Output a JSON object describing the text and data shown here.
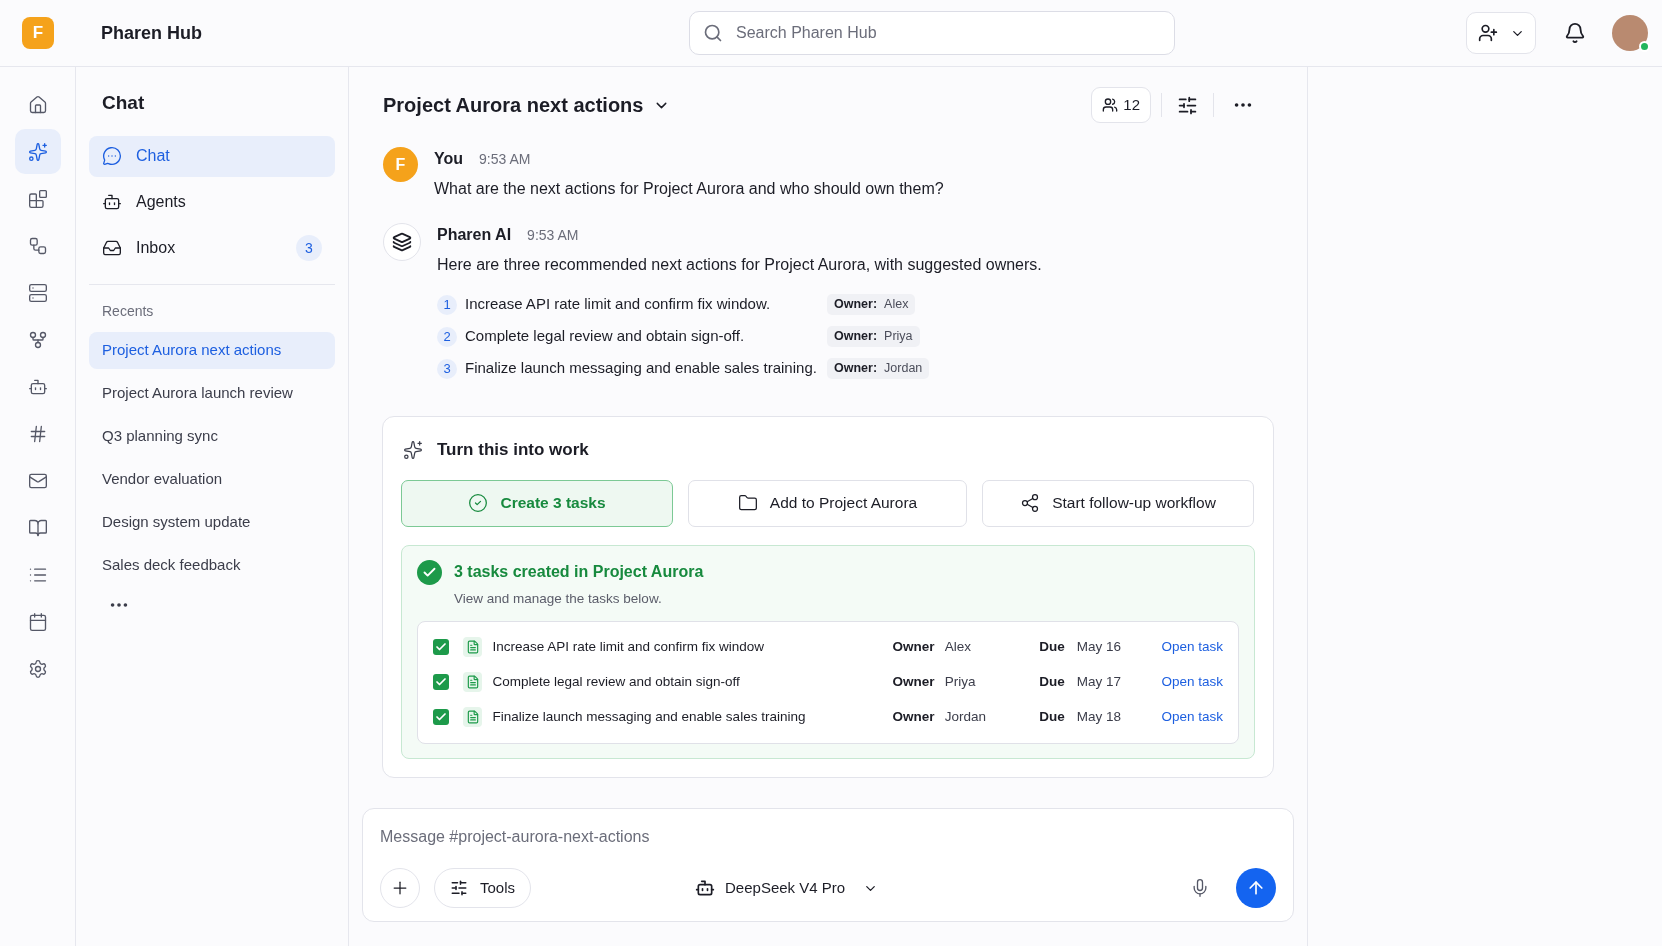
{
  "app": {
    "logo_letter": "F",
    "name": "Pharen Hub"
  },
  "search": {
    "placeholder": "Search Pharen Hub"
  },
  "user": {
    "online": true
  },
  "rail": [
    {
      "kind": "home",
      "selected": false
    },
    {
      "kind": "sparkles",
      "selected": true
    },
    {
      "kind": "blocks",
      "selected": false
    },
    {
      "kind": "flows",
      "selected": false
    },
    {
      "kind": "storage",
      "selected": false
    },
    {
      "kind": "nodes",
      "selected": false
    },
    {
      "kind": "bot",
      "selected": false
    },
    {
      "kind": "hash",
      "selected": false
    },
    {
      "kind": "mail",
      "selected": false
    },
    {
      "kind": "book",
      "selected": false
    },
    {
      "kind": "list",
      "selected": false
    },
    {
      "kind": "calendar",
      "selected": false
    },
    {
      "kind": "settings",
      "selected": false
    }
  ],
  "sidebar": {
    "title": "Chat",
    "items": [
      {
        "kind": "chat",
        "label": "Chat",
        "selected": true
      },
      {
        "kind": "agents",
        "label": "Agents",
        "selected": false
      },
      {
        "kind": "inbox",
        "label": "Inbox",
        "selected": false,
        "badge": "3"
      }
    ],
    "recents_label": "Recents",
    "recents": [
      {
        "label": "Project Aurora next actions",
        "selected": true
      },
      {
        "label": "Project Aurora launch review",
        "selected": false
      },
      {
        "label": "Q3 planning sync",
        "selected": false
      },
      {
        "label": "Vendor evaluation",
        "selected": false
      },
      {
        "label": "Design system update",
        "selected": false
      },
      {
        "label": "Sales deck feedback",
        "selected": false
      }
    ]
  },
  "chat": {
    "title": "Project Aurora next actions",
    "members": "12",
    "messages": [
      {
        "kind": "user",
        "avatar": "F",
        "author": "You",
        "time": "9:53 AM",
        "text": "What are the next actions for Project Aurora and who should own them?"
      },
      {
        "kind": "ai",
        "author": "Pharen AI",
        "time": "9:53 AM",
        "text": "Here are three recommended next actions for Project Aurora, with suggested owners.",
        "actions": [
          {
            "number": "1",
            "text": "Increase API rate limit and confirm fix window.",
            "owner_label": "Owner:",
            "owner": "Alex"
          },
          {
            "number": "2",
            "text": "Complete legal review and obtain sign-off.",
            "owner_label": "Owner:",
            "owner": "Priya"
          },
          {
            "number": "3",
            "text": "Finalize launch messaging and enable sales training.",
            "owner_label": "Owner:",
            "owner": "Jordan"
          }
        ]
      }
    ]
  },
  "work_card": {
    "title": "Turn this into work",
    "buttons": [
      {
        "kind": "tasks",
        "label": "Create 3 tasks",
        "selected": true
      },
      {
        "kind": "project",
        "label": "Add to Project Aurora",
        "selected": false
      },
      {
        "kind": "workflow",
        "label": "Start follow-up workflow",
        "selected": false
      }
    ],
    "result": {
      "title": "3 tasks created in Project Aurora",
      "subtitle": "View and manage the tasks below.",
      "tasks": [
        {
          "checked": true,
          "text": "Increase API rate limit and confirm fix window",
          "owner_label": "Owner",
          "owner": "Alex",
          "due_label": "Due",
          "due": "May 16",
          "link": "Open task"
        },
        {
          "checked": true,
          "text": "Complete legal review and obtain sign-off",
          "owner_label": "Owner",
          "owner": "Priya",
          "due_label": "Due",
          "due": "May 17",
          "link": "Open task"
        },
        {
          "checked": true,
          "text": "Finalize launch messaging and enable sales training",
          "owner_label": "Owner",
          "owner": "Jordan",
          "due_label": "Due",
          "due": "May 18",
          "link": "Open task"
        }
      ]
    }
  },
  "composer": {
    "placeholder": "Message #project-aurora-next-actions",
    "tools": "Tools",
    "model": "DeepSeek V4 Pro"
  }
}
